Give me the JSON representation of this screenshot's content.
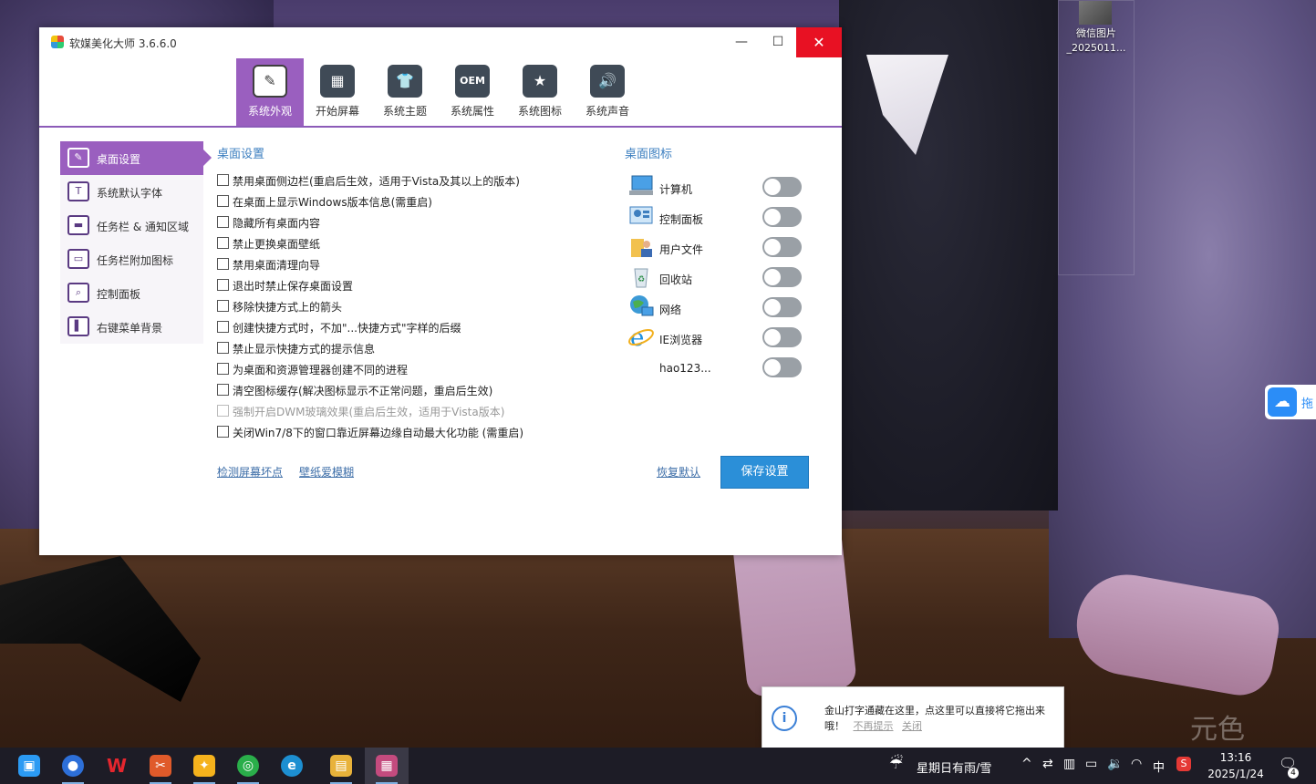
{
  "window": {
    "title": "软媒美化大师 3.6.6.0",
    "minimize": "—",
    "maximize": "☐",
    "close": "✕"
  },
  "top_tabs": [
    {
      "label": "系统外观",
      "icon": "brush-icon",
      "glyph": "✎",
      "active": true
    },
    {
      "label": "开始屏幕",
      "icon": "start-screen-icon",
      "glyph": "▦",
      "active": false
    },
    {
      "label": "系统主题",
      "icon": "shirt-icon",
      "glyph": "👕",
      "active": false
    },
    {
      "label": "系统属性",
      "icon": "oem-icon",
      "glyph": "OEM",
      "active": false
    },
    {
      "label": "系统图标",
      "icon": "star-icon",
      "glyph": "★",
      "active": false
    },
    {
      "label": "系统声音",
      "icon": "speaker-icon",
      "glyph": "🔊",
      "active": false
    }
  ],
  "left_menu": [
    {
      "label": "桌面设置",
      "glyph": "✎",
      "active": true
    },
    {
      "label": "系统默认字体",
      "glyph": "T",
      "active": false
    },
    {
      "label": "任务栏 & 通知区域",
      "glyph": "▬",
      "active": false
    },
    {
      "label": "任务栏附加图标",
      "glyph": "▭",
      "active": false
    },
    {
      "label": "控制面板",
      "glyph": "⌕",
      "active": false
    },
    {
      "label": "右键菜单背景",
      "glyph": "▌",
      "active": false
    }
  ],
  "desktop_settings": {
    "title": "桌面设置",
    "options": [
      {
        "label": "禁用桌面侧边栏(重启后生效，适用于Vista及其以上的版本)",
        "checked": false,
        "disabled": false
      },
      {
        "label": "在桌面上显示Windows版本信息(需重启)",
        "checked": false,
        "disabled": false
      },
      {
        "label": "隐藏所有桌面内容",
        "checked": false,
        "disabled": false
      },
      {
        "label": "禁止更换桌面壁纸",
        "checked": false,
        "disabled": false
      },
      {
        "label": "禁用桌面清理向导",
        "checked": false,
        "disabled": false
      },
      {
        "label": "退出时禁止保存桌面设置",
        "checked": false,
        "disabled": false
      },
      {
        "label": "移除快捷方式上的箭头",
        "checked": false,
        "disabled": false
      },
      {
        "label": "创建快捷方式时，不加\"...快捷方式\"字样的后缀",
        "checked": false,
        "disabled": false
      },
      {
        "label": "禁止显示快捷方式的提示信息",
        "checked": false,
        "disabled": false
      },
      {
        "label": "为桌面和资源管理器创建不同的进程",
        "checked": false,
        "disabled": false
      },
      {
        "label": "清空图标缓存(解决图标显示不正常问题，重启后生效)",
        "checked": false,
        "disabled": false
      },
      {
        "label": "强制开启DWM玻璃效果(重启后生效，适用于Vista版本)",
        "checked": false,
        "disabled": true
      },
      {
        "label": "关闭Win7/8下的窗口靠近屏幕边缘自动最大化功能 (需重启)",
        "checked": false,
        "disabled": false
      }
    ]
  },
  "desktop_icons": {
    "title": "桌面图标",
    "items": [
      {
        "label": "计算机",
        "icon": "computer-icon",
        "on": false
      },
      {
        "label": "控制面板",
        "icon": "control-panel-icon",
        "on": false
      },
      {
        "label": "用户文件",
        "icon": "user-files-icon",
        "on": false
      },
      {
        "label": "回收站",
        "icon": "recycle-bin-icon",
        "on": false
      },
      {
        "label": "网络",
        "icon": "network-icon",
        "on": false
      },
      {
        "label": "IE浏览器",
        "icon": "ie-icon",
        "on": false
      },
      {
        "label": "hao123...",
        "icon": "",
        "on": false
      }
    ]
  },
  "links": {
    "check_pixels": "检测屏幕坏点",
    "wallpaper": "壁纸爱模糊",
    "restore": "恢复默认"
  },
  "save_button": "保存设置",
  "desktop": {
    "icon_label_1": "微信图片",
    "icon_label_2": "_2025011...",
    "side_widget_text": "拖",
    "watermark": "元色"
  },
  "notification": {
    "text": "金山打字通藏在这里，点这里可以直接将它拖出来哦！",
    "no_remind": "不再提示",
    "close": "关闭",
    "icon_glyph": "i"
  },
  "taskbar": {
    "apps": [
      {
        "name": "explorer-lite",
        "glyph": "▣",
        "color": "#2b9af3"
      },
      {
        "name": "browser-blue",
        "glyph": "●",
        "color": "#2d6fd8"
      },
      {
        "name": "wps",
        "glyph": "W",
        "color": "#d5232c"
      },
      {
        "name": "tool-app",
        "glyph": "✂",
        "color": "#e05a2a"
      },
      {
        "name": "folder-app",
        "glyph": "✦",
        "color": "#f5b21c"
      },
      {
        "name": "wechat",
        "glyph": "◎",
        "color": "#2aae4a"
      },
      {
        "name": "edge",
        "glyph": "e",
        "color": "#1d8fd1"
      },
      {
        "name": "file-explorer",
        "glyph": "▤",
        "color": "#e8b23a"
      },
      {
        "name": "ruanmei-master",
        "glyph": "▦",
        "color": "#c44b7e"
      }
    ],
    "weather": "星期日有雨/雪",
    "ime": "中",
    "time": "13:16",
    "date": "2025/1/24",
    "notify_count": "4"
  }
}
